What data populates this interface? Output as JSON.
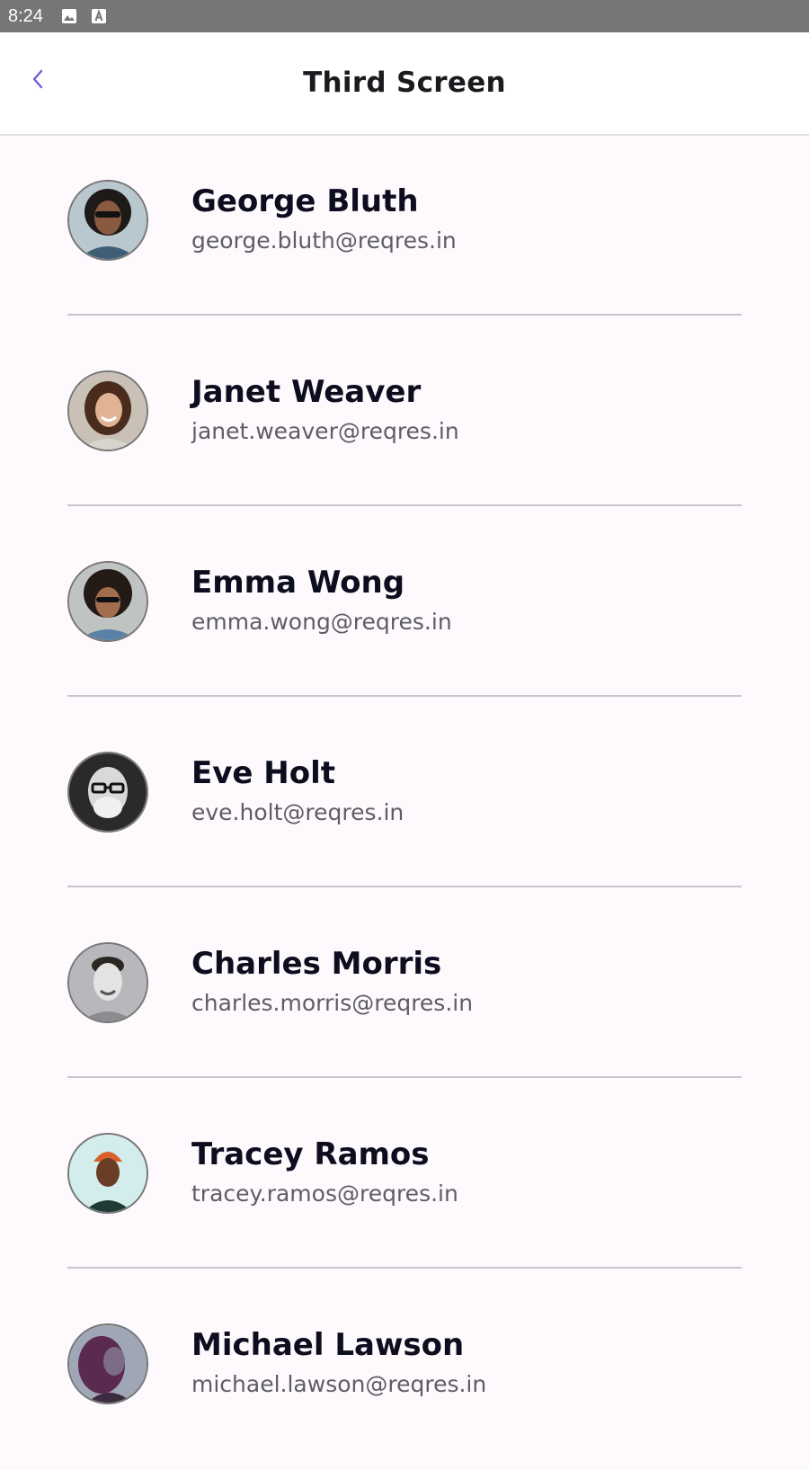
{
  "status_bar": {
    "time": "8:24",
    "icons": [
      "image-icon",
      "text-a-icon"
    ]
  },
  "app_bar": {
    "title": "Third Screen",
    "back_icon": "chevron-left-icon",
    "accent_color": "#6b5fd8"
  },
  "users": [
    {
      "name": "George Bluth",
      "email": "george.bluth@reqres.in",
      "avatar": "avatar-photo"
    },
    {
      "name": "Janet Weaver",
      "email": "janet.weaver@reqres.in",
      "avatar": "avatar-photo"
    },
    {
      "name": "Emma Wong",
      "email": "emma.wong@reqres.in",
      "avatar": "avatar-photo"
    },
    {
      "name": "Eve Holt",
      "email": "eve.holt@reqres.in",
      "avatar": "avatar-photo"
    },
    {
      "name": "Charles Morris",
      "email": "charles.morris@reqres.in",
      "avatar": "avatar-photo"
    },
    {
      "name": "Tracey Ramos",
      "email": "tracey.ramos@reqres.in",
      "avatar": "avatar-photo"
    },
    {
      "name": "Michael Lawson",
      "email": "michael.lawson@reqres.in",
      "avatar": "avatar-photo"
    }
  ]
}
